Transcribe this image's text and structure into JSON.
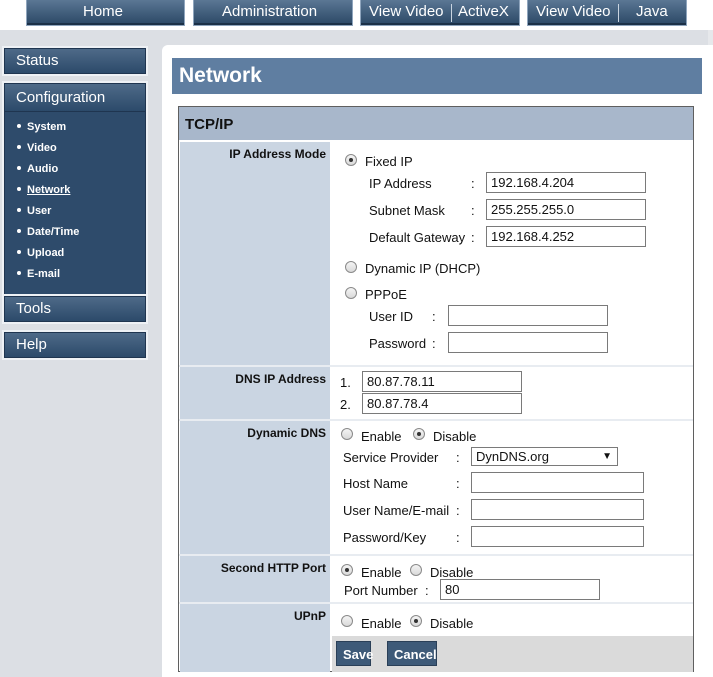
{
  "nav": {
    "home": "Home",
    "administration": "Administration",
    "view_video_1": "View Video",
    "activex": "ActiveX",
    "view_video_2": "View Video",
    "java": "Java"
  },
  "sidebar": {
    "status": "Status",
    "configuration": "Configuration",
    "items": [
      {
        "label": "System"
      },
      {
        "label": "Video"
      },
      {
        "label": "Audio"
      },
      {
        "label": "Network"
      },
      {
        "label": "User"
      },
      {
        "label": "Date/Time"
      },
      {
        "label": "Upload"
      },
      {
        "label": "E-mail"
      }
    ],
    "tools": "Tools",
    "help": "Help"
  },
  "page": {
    "title": "Network",
    "section_title": "TCP/IP"
  },
  "ip_mode": {
    "label": "IP Address Mode",
    "fixed_ip": "Fixed IP",
    "ip_address_label": "IP Address",
    "ip_address": "192.168.4.204",
    "subnet_mask_label": "Subnet Mask",
    "subnet_mask": "255.255.255.0",
    "gateway_label": "Default Gateway",
    "gateway": "192.168.4.252",
    "dhcp": "Dynamic IP (DHCP)",
    "pppoe": "PPPoE",
    "user_id_label": "User ID",
    "user_id": "",
    "password_label": "Password",
    "password": "",
    "colon": ":"
  },
  "dns": {
    "label": "DNS IP Address",
    "n1": "1.",
    "dns1": "80.87.78.11",
    "n2": "2.",
    "dns2": "80.87.78.4"
  },
  "ddns": {
    "label": "Dynamic DNS",
    "enable": "Enable",
    "disable": "Disable",
    "provider_label": "Service Provider",
    "provider": "DynDNS.org",
    "host_label": "Host Name",
    "host": "",
    "user_label": "User Name/E-mail",
    "user": "",
    "pass_label": "Password/Key",
    "pass": "",
    "colon": ":"
  },
  "http2": {
    "label": "Second HTTP Port",
    "enable": "Enable",
    "disable": "Disable",
    "port_label": "Port Number",
    "port": "80",
    "colon": ":"
  },
  "upnp": {
    "label": "UPnP",
    "enable": "Enable",
    "disable": "Disable"
  },
  "buttons": {
    "save": "Save",
    "cancel": "Cancel"
  },
  "colors": {
    "nav_blue": "#2a4765",
    "title_bar": "#5f7ea1",
    "label_bg": "#cad5e2",
    "header_bg": "#a8b7cb"
  }
}
